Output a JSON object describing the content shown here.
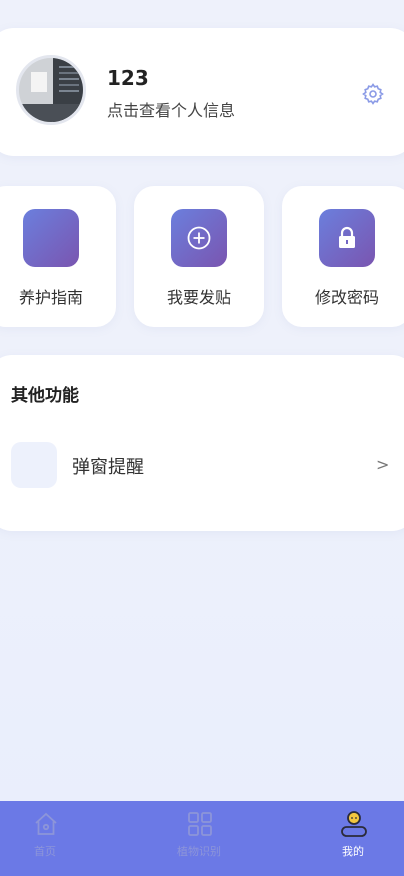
{
  "profile": {
    "username": "123",
    "subtitle": "点击查看个人信息"
  },
  "actions": [
    {
      "label": "养护指南",
      "icon": "care-guide-icon"
    },
    {
      "label": "我要发贴",
      "icon": "plus-circle-icon"
    },
    {
      "label": "修改密码",
      "icon": "lock-icon"
    }
  ],
  "other": {
    "title": "其他功能",
    "items": [
      {
        "label": "弹窗提醒",
        "chevron": ">"
      }
    ]
  },
  "tabbar": {
    "items": [
      {
        "label": "首页",
        "icon": "home-icon",
        "active": false
      },
      {
        "label": "植物识别",
        "icon": "grid-icon",
        "active": false
      },
      {
        "label": "我的",
        "icon": "user-icon",
        "active": true
      }
    ]
  },
  "colors": {
    "accent": "#6b79e6",
    "icon_gradient_start": "#6b7fdd",
    "icon_gradient_end": "#7a55b0"
  }
}
